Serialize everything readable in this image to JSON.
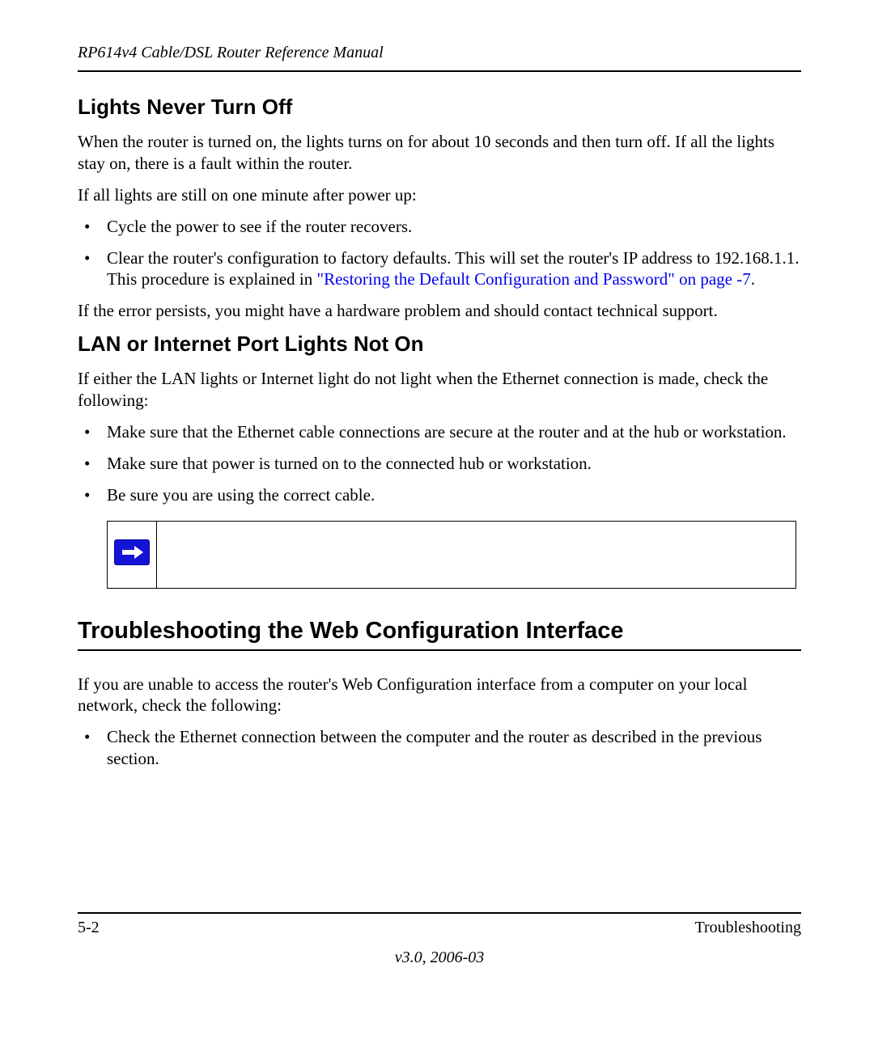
{
  "header": {
    "doc_title": "RP614v4 Cable/DSL Router Reference Manual"
  },
  "section1": {
    "heading": "Lights Never Turn Off",
    "p1": "When the router is turned on, the lights turns on for about 10 seconds and then turn off. If all the lights stay on, there is a fault within the router.",
    "p2": "If all lights are still on one minute after power up:",
    "bullets": {
      "b1": "Cycle the power to see if the router recovers.",
      "b2_pre": "Clear the router's configuration to factory defaults. This will set the router's IP address to 192.168.1.1. This procedure is explained in ",
      "b2_link": "\"Restoring the Default Configuration and Password\" on page -7",
      "b2_post": "."
    },
    "p3": "If the error persists, you might have a hardware problem and should contact technical support."
  },
  "section2": {
    "heading": "LAN or Internet Port Lights Not On",
    "p1": "If either the LAN lights or Internet light do not light when the Ethernet connection is made, check the following:",
    "bullets": {
      "b1": "Make sure that the Ethernet cable connections are secure at the router and at the hub or workstation.",
      "b2": "Make sure that power is turned on to the connected hub or workstation.",
      "b3": "Be sure you are using the correct cable."
    }
  },
  "section3": {
    "heading": "Troubleshooting the Web Configuration Interface",
    "p1": "If you are unable to access the router's Web Configuration interface from a computer on your local network, check the following:",
    "bullets": {
      "b1": "Check the Ethernet connection between the computer and the router as described in the previous section."
    }
  },
  "footer": {
    "page_num": "5-2",
    "chapter": "Troubleshooting",
    "version": "v3.0, 2006-03"
  }
}
